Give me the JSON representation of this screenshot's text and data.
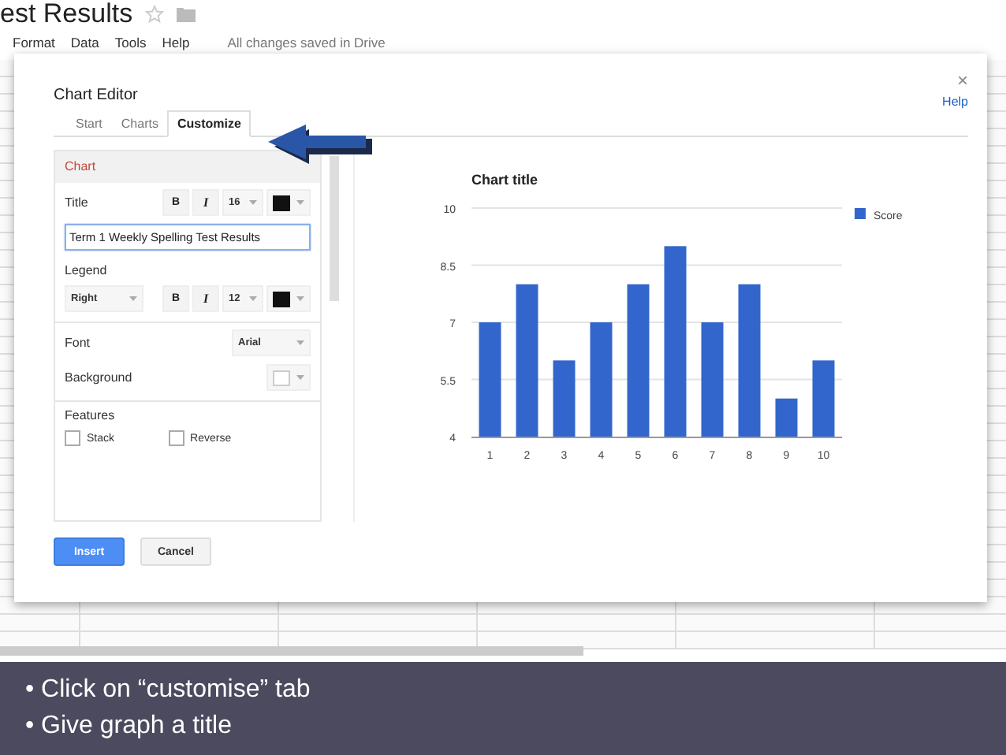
{
  "doc": {
    "title": "est Results",
    "menu": [
      "Format",
      "Data",
      "Tools",
      "Help"
    ],
    "save_status": "All changes saved in Drive"
  },
  "dialog": {
    "title": "Chart Editor",
    "close": "×",
    "help": "Help",
    "tabs": [
      {
        "label": "Start",
        "selected": false
      },
      {
        "label": "Charts",
        "selected": false
      },
      {
        "label": "Customize",
        "selected": true
      }
    ],
    "panel": {
      "heading": "Chart",
      "title_label": "Title",
      "title_bold": "B",
      "title_italic": "I",
      "title_size": "16",
      "title_value": "Term 1 Weekly Spelling Test Results",
      "legend_label": "Legend",
      "legend_position": "Right",
      "legend_bold": "B",
      "legend_italic": "I",
      "legend_size": "12",
      "font_label": "Font",
      "font_value": "Arial",
      "background_label": "Background",
      "features_label": "Features",
      "features": [
        {
          "label": "Stack",
          "checked": false
        },
        {
          "label": "Reverse",
          "checked": false
        }
      ]
    },
    "chart": {
      "chart_data": {
        "type": "bar",
        "title": "Chart title",
        "categories": [
          "1",
          "2",
          "3",
          "4",
          "5",
          "6",
          "7",
          "8",
          "9",
          "10"
        ],
        "series": [
          {
            "name": "Score",
            "color": "#3366cc",
            "values": [
              7,
              8,
              6,
              7,
              8,
              9,
              7,
              8,
              5,
              6
            ]
          }
        ],
        "ylim": [
          4,
          10
        ],
        "yticks": [
          4,
          5.5,
          7,
          8.5,
          10
        ],
        "grid": true
      }
    },
    "buttons": [
      {
        "label": "Insert",
        "kind": "primary"
      },
      {
        "label": "Cancel",
        "kind": "secondary"
      }
    ]
  },
  "caption": [
    "• Click on “customise” tab",
    "• Give graph a title"
  ]
}
